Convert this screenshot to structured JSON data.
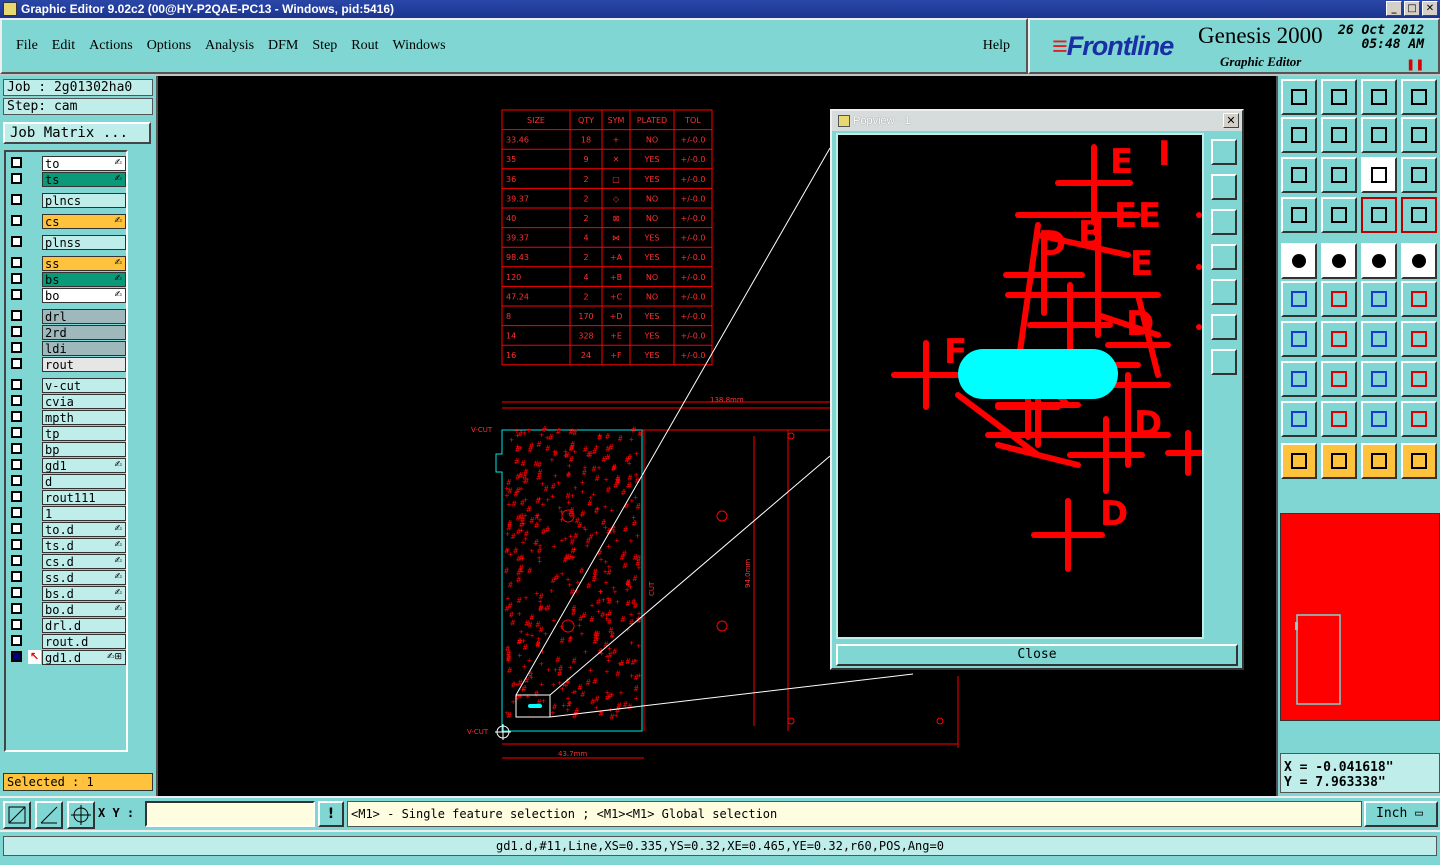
{
  "window": {
    "title": "Graphic Editor 9.02c2 (00@HY-P2QAE-PC13 - Windows, pid:5416)"
  },
  "menu": {
    "items": [
      "File",
      "Edit",
      "Actions",
      "Options",
      "Analysis",
      "DFM",
      "Step",
      "Rout",
      "Windows"
    ],
    "help": "Help"
  },
  "brand": {
    "logo": "Frontline",
    "product": "Genesis 2000",
    "subtitle": "Graphic Editor",
    "date": "26 Oct 2012",
    "time": "05:48 AM"
  },
  "job": {
    "job_label": "Job : 2g01302ha0",
    "step_label": "Step: cam",
    "matrix_button": "Job Matrix ..."
  },
  "layers": [
    {
      "name": "to",
      "bg": "#ffffff",
      "flag": "✍"
    },
    {
      "name": "ts",
      "bg": "#0a9a7a",
      "flag": "✍"
    },
    {
      "name": "plncs",
      "bg": "#bfeeea",
      "flag": ""
    },
    {
      "name": "cs",
      "bg": "#ffc23c",
      "flag": "✍"
    },
    {
      "name": "plnss",
      "bg": "#bfeeea",
      "flag": ""
    },
    {
      "name": "ss",
      "bg": "#ffc23c",
      "flag": "✍"
    },
    {
      "name": "bs",
      "bg": "#0a9a7a",
      "flag": "✍"
    },
    {
      "name": "bo",
      "bg": "#ffffff",
      "flag": "✍"
    },
    {
      "name": "drl",
      "bg": "#9fb8bc",
      "flag": ""
    },
    {
      "name": "2rd",
      "bg": "#9fb8bc",
      "flag": ""
    },
    {
      "name": "ldi",
      "bg": "#9fb8bc",
      "flag": ""
    },
    {
      "name": "rout",
      "bg": "#e6e6e6",
      "flag": ""
    },
    {
      "name": "v-cut",
      "bg": "#bfeeea",
      "flag": ""
    },
    {
      "name": "cvia",
      "bg": "#bfeeea",
      "flag": ""
    },
    {
      "name": "mpth",
      "bg": "#bfeeea",
      "flag": ""
    },
    {
      "name": "tp",
      "bg": "#bfeeea",
      "flag": ""
    },
    {
      "name": "bp",
      "bg": "#bfeeea",
      "flag": ""
    },
    {
      "name": "gd1",
      "bg": "#bfeeea",
      "flag": "✍"
    },
    {
      "name": "d",
      "bg": "#bfeeea",
      "flag": ""
    },
    {
      "name": "rout111",
      "bg": "#bfeeea",
      "flag": ""
    },
    {
      "name": "1",
      "bg": "#bfeeea",
      "flag": ""
    },
    {
      "name": "to.d",
      "bg": "#bfeeea",
      "flag": "✍"
    },
    {
      "name": "ts.d",
      "bg": "#bfeeea",
      "flag": "✍"
    },
    {
      "name": "cs.d",
      "bg": "#bfeeea",
      "flag": "✍"
    },
    {
      "name": "ss.d",
      "bg": "#bfeeea",
      "flag": "✍"
    },
    {
      "name": "bs.d",
      "bg": "#bfeeea",
      "flag": "✍"
    },
    {
      "name": "bo.d",
      "bg": "#bfeeea",
      "flag": "✍"
    },
    {
      "name": "drl.d",
      "bg": "#bfeeea",
      "flag": ""
    },
    {
      "name": "rout.d",
      "bg": "#bfeeea",
      "flag": ""
    },
    {
      "name": "gd1.d",
      "bg": "#bfeeea",
      "flag": "✍⊞"
    }
  ],
  "selected": "Selected : 1",
  "drill_table": {
    "headers": [
      "SIZE",
      "QTY",
      "SYM",
      "PLATED",
      "TOL"
    ],
    "rows": [
      [
        "33.46",
        "18",
        "+",
        "NO",
        "+/-0.0"
      ],
      [
        "35",
        "9",
        "✕",
        "YES",
        "+/-0.0"
      ],
      [
        "36",
        "2",
        "□",
        "YES",
        "+/-0.0"
      ],
      [
        "39.37",
        "2",
        "◇",
        "NO",
        "+/-0.0"
      ],
      [
        "40",
        "2",
        "⊠",
        "NO",
        "+/-0.0"
      ],
      [
        "39.37",
        "4",
        "⋈",
        "YES",
        "+/-0.0"
      ],
      [
        "98.43",
        "2",
        "+A",
        "YES",
        "+/-0.0"
      ],
      [
        "120",
        "4",
        "+B",
        "NO",
        "+/-0.0"
      ],
      [
        "47.24",
        "2",
        "+C",
        "NO",
        "+/-0.0"
      ],
      [
        "8",
        "170",
        "+D",
        "YES",
        "+/-0.0"
      ],
      [
        "14",
        "328",
        "+E",
        "YES",
        "+/-0.0"
      ],
      [
        "16",
        "24",
        "+F",
        "YES",
        "+/-0.0"
      ]
    ]
  },
  "board": {
    "vcut_top": "V-CUT",
    "vcut_bottom": "V-CUT",
    "dim_width": "138.8mm",
    "dim_small": "43.7mm",
    "dim_height": "94.0mm",
    "cut_label": "CUT"
  },
  "popview": {
    "title": "Popview - 1",
    "close_label": "Close",
    "letters": [
      "E",
      "I",
      "E",
      "E",
      "E",
      "D",
      "D",
      "D",
      "D",
      "B",
      "F"
    ]
  },
  "coords": {
    "x": "X = -0.041618\"",
    "y": "Y = 7.963338\""
  },
  "bottom": {
    "xy_label": "X Y :",
    "xy_value": "",
    "hint": "<M1> - Single feature selection ; <M1><M1> Global selection",
    "units": "Inch"
  },
  "status": "gd1.d,#11,Line,XS=0.335,YS=0.32,XE=0.465,YE=0.32,r60,POS,Ang=0",
  "colors": {
    "panel": "#7fd6d2",
    "feature": "#ff0000",
    "highlight": "#00ffff",
    "accent": "#ffc23c"
  }
}
